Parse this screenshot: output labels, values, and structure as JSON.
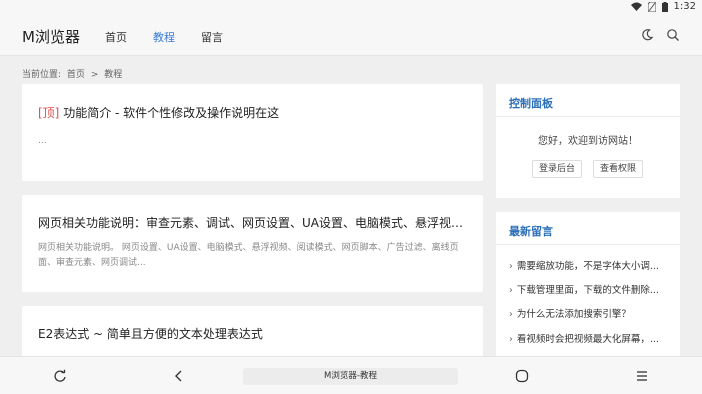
{
  "status": {
    "time": "1:32"
  },
  "header": {
    "brand": "M浏览器",
    "nav": [
      {
        "label": "首页"
      },
      {
        "label": "教程",
        "active": true
      },
      {
        "label": "留言"
      }
    ]
  },
  "breadcrumb": {
    "prefix": "当前位置:",
    "home": "首页",
    "sep": ">",
    "current": "教程"
  },
  "articles": [
    {
      "pin": "[顶]",
      "title": "功能简介 - 软件个性修改及操作说明在这",
      "excerpt": "..."
    },
    {
      "title": "网页相关功能说明：审查元素、调试、网页设置、UA设置、电脑模式、悬浮视频...",
      "excerpt": "网页相关功能说明。 网页设置、UA设置、电脑模式、悬浮视频、阅读模式、网页脚本、广告过滤、离线页面、审查元素、网页调试..."
    },
    {
      "title": "E2表达式 ~ 简单且方便的文本处理表达式",
      "excerpt": ""
    }
  ],
  "control_panel": {
    "heading": "控制面板",
    "welcome": "您好，欢迎到访网站！",
    "login_label": "登录后台",
    "perm_label": "查看权限"
  },
  "latest": {
    "heading": "最新留言",
    "items": [
      "需要缩放功能，不是字体大小调...",
      "下载管理里面，下载的文件删除...",
      "为什么无法添加搜索引擎？",
      "看视频时会把视频最大化屏幕，..."
    ]
  },
  "bottom": {
    "url_text": "M浏览器-教程"
  },
  "colors": {
    "accent": "#3a7bd5",
    "pin": "#d9534f",
    "heading": "#2a6fb8"
  }
}
